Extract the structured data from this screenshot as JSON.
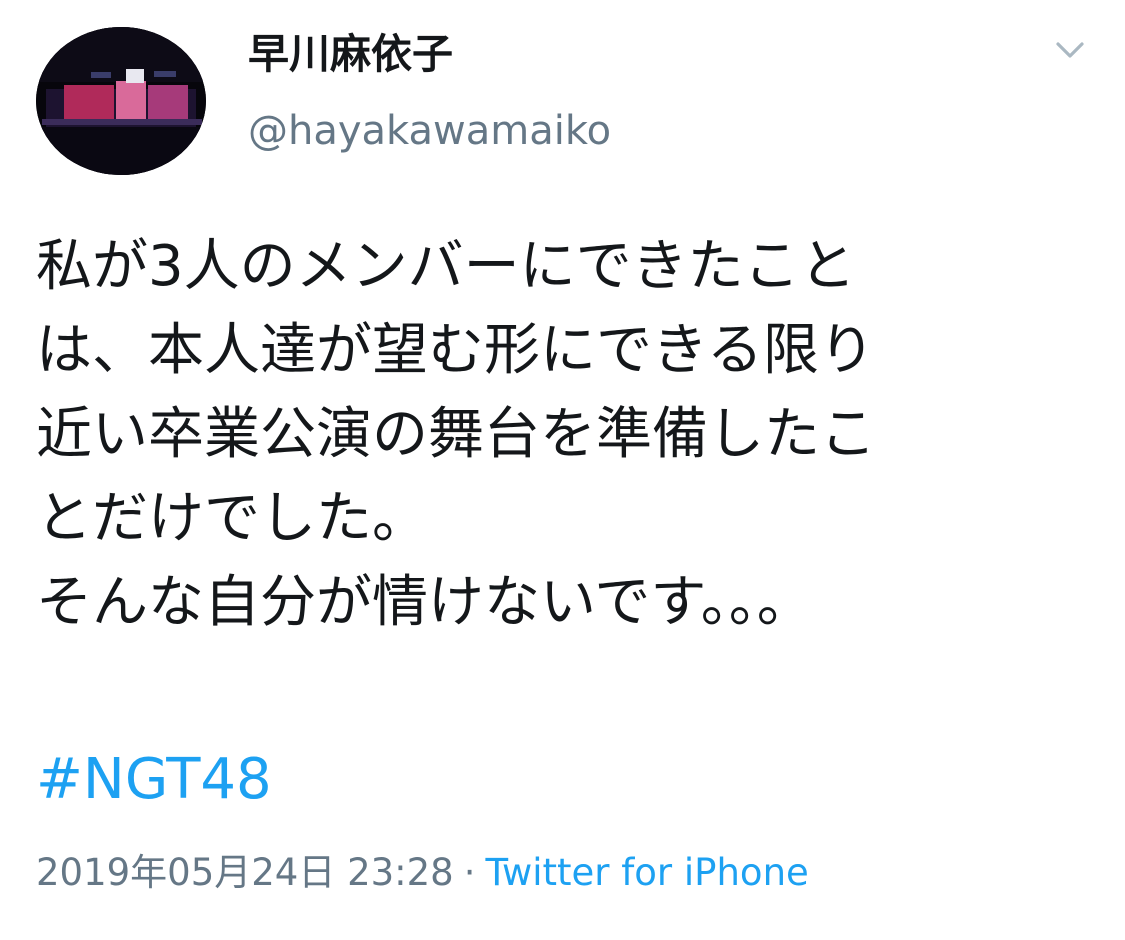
{
  "user": {
    "display_name": "早川麻依子",
    "handle": "@hayakawamaiko"
  },
  "tweet": {
    "text_lines": [
      "私が3人のメンバーにできたこと",
      "は、本人達が望む形にできる限り",
      "近い卒業公演の舞台を準備したこ",
      "とだけでした。",
      "そんな自分が情けないです。。。"
    ],
    "hashtag": "#NGT48",
    "timestamp": "2019年05月24日 23:28",
    "separator": "·",
    "source": "Twitter for iPhone"
  },
  "icons": {
    "menu": "chevron-down-icon",
    "avatar": "stage-photo"
  },
  "colors": {
    "text": "#14171a",
    "secondary": "#657786",
    "link": "#1da1f2",
    "background": "#ffffff"
  }
}
